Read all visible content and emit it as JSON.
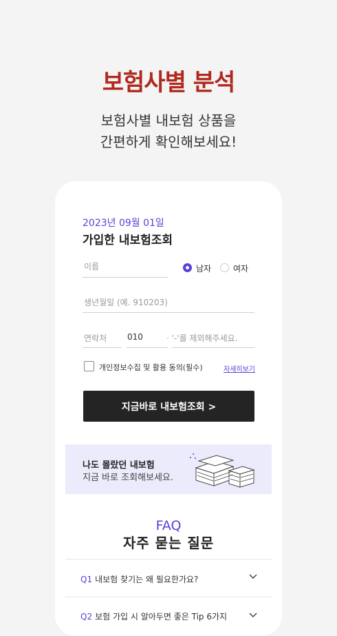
{
  "hero": {
    "title": "보험사별 분석",
    "subtitle_line1": "보험사별 내보험 상품을",
    "subtitle_line2": "간편하게 확인해보세요!"
  },
  "form": {
    "date": "2023년 09월 01일",
    "title": "가입한 내보험조회",
    "name_placeholder": "이름",
    "gender_male": "남자",
    "gender_female": "여자",
    "gender_selected": "남자",
    "birth_placeholder": "생년월일 (예. 910203)",
    "phone_label": "연락처",
    "phone_prefix": "010",
    "phone_placeholder": "'-'를 제외해주세요.",
    "agree_label": "개인정보수집 및 활용 동의(필수)",
    "agree_checked": false,
    "detail_link": "자세히보기",
    "submit": "지금바로 내보험조회 >"
  },
  "banner": {
    "title": "나도 몰랐던 내보험",
    "subtitle": "지금 바로 조회해보세요."
  },
  "faq": {
    "label": "FAQ",
    "title": "자주 묻는 질문",
    "items": [
      {
        "num": "Q1",
        "text": "내보험 찾기는 왜 필요한가요?"
      },
      {
        "num": "Q2",
        "text": "보험 가입 시 알아두면 좋은 Tip 6가지"
      }
    ]
  },
  "colors": {
    "accent": "#5b3fd6",
    "title_red": "#b0291f",
    "button_dark": "#242424",
    "banner_bg": "#ecebfb"
  }
}
